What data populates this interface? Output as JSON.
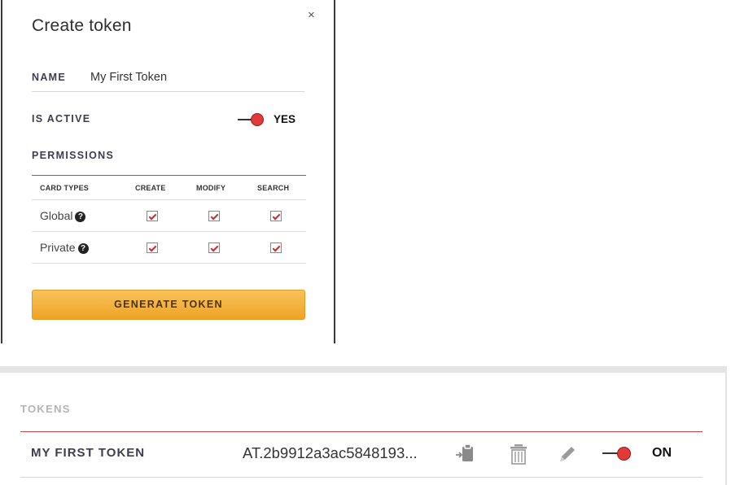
{
  "modal": {
    "title": "Create token",
    "close_label": "×",
    "name_label": "NAME",
    "name_value": "My First Token",
    "is_active_label": "IS ACTIVE",
    "is_active_value": "YES",
    "permissions_label": "PERMISSIONS",
    "table": {
      "headers": [
        "CARD TYPES",
        "CREATE",
        "MODIFY",
        "SEARCH"
      ],
      "rows": [
        {
          "label": "Global",
          "create": true,
          "modify": true,
          "search": true
        },
        {
          "label": "Private",
          "create": true,
          "modify": true,
          "search": true
        }
      ]
    },
    "generate_label": "GENERATE TOKEN"
  },
  "tokens": {
    "title": "TOKENS",
    "items": [
      {
        "name": "MY FIRST TOKEN",
        "value": "AT.2b9912a3ac5848193...",
        "status": "ON",
        "icons": [
          "clipboard-icon",
          "trash-icon",
          "pencil-icon"
        ]
      }
    ]
  },
  "colors": {
    "accent_red": "#e03a3a",
    "rule_red": "#c8454a",
    "button_orange": "#f2ac35"
  }
}
